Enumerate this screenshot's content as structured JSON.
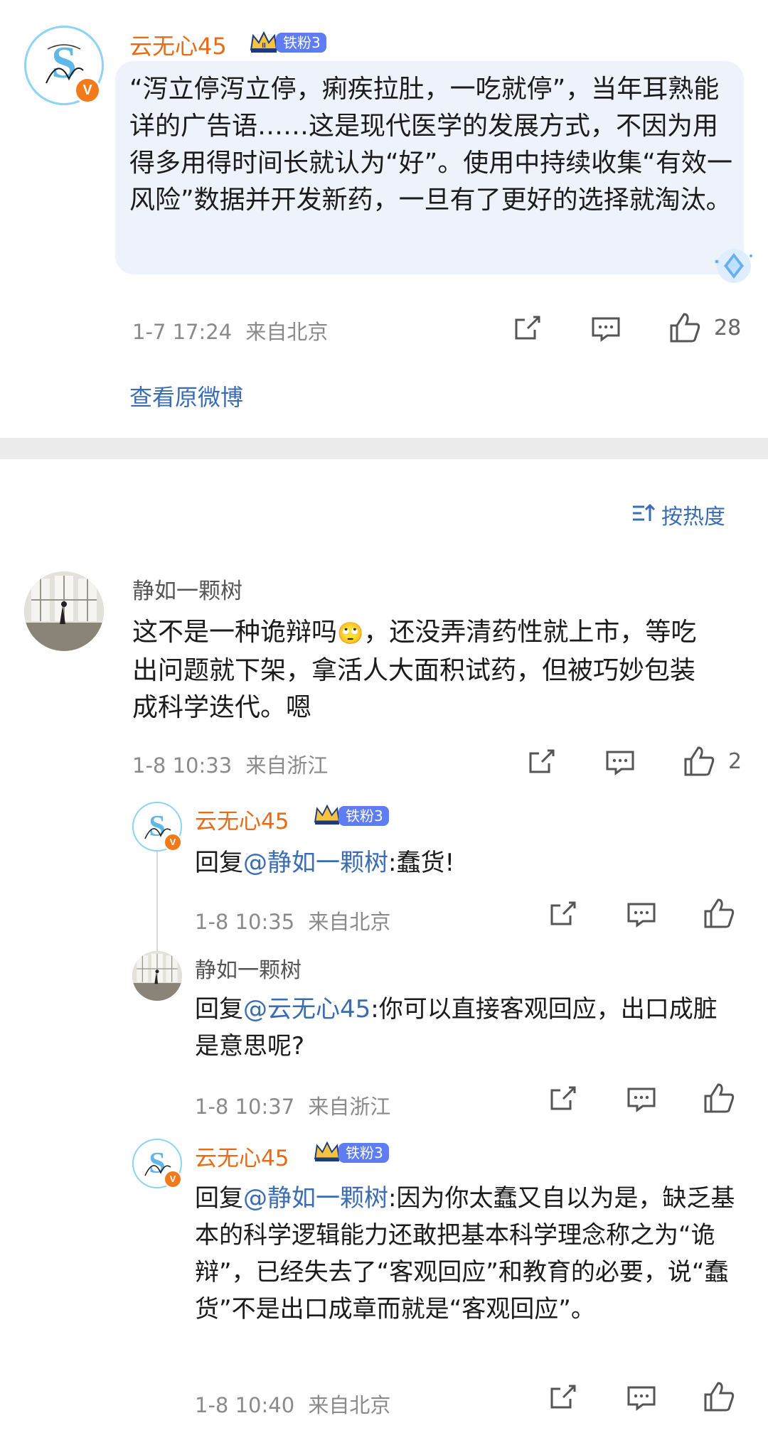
{
  "post": {
    "author": "云无心45",
    "fan_badge": "铁粉3",
    "text": "“泻立停泻立停，痢疾拉肚，一吃就停”，当年耳熟能详的广告语……这是现代医学的发展方式，不因为用得多用得时间长就认为“好”。使用中持续收集“有效一风险”数据并开发新药，一旦有了更好的选择就淘汰。",
    "time": "1-7 17:24",
    "location": "来自北京",
    "like_count": "28",
    "view_original": "查看原微博"
  },
  "sort_label": "按热度",
  "comments": [
    {
      "author": "静如一颗树",
      "text_before": "这不是一种诡辩吗",
      "emoji": "🙄",
      "text_after": "，还没弄清药性就上市，等吃出问题就下架，拿活人大面积试药，但被巧妙包装成科学迭代。嗯",
      "time": "1-8 10:33",
      "location": "来自浙江",
      "like_count": "2"
    }
  ],
  "replies": [
    {
      "author": "云无心45",
      "fan_badge": "铁粉3",
      "prefix": "回复",
      "mention": "@静如一颗树",
      "text": ":蠢货!",
      "time": "1-8 10:35",
      "location": "来自北京"
    },
    {
      "author": "静如一颗树",
      "prefix": "回复",
      "mention": "@云无心45",
      "text": ":你可以直接客观回应，出口成脏是意思呢?",
      "time": "1-8 10:37",
      "location": "来自浙江"
    },
    {
      "author": "云无心45",
      "fan_badge": "铁粉3",
      "prefix": "回复",
      "mention": "@静如一颗树",
      "text": ":因为你太蠢又自以为是，缺乏基本的科学逻辑能力还敢把基本科学理念称之为“诡辩”，已经失去了“客观回应”和教育的必要，说“蠢货”不是出口成章而就是“客观回应”。",
      "time": "1-8 10:40",
      "location": "来自北京"
    }
  ],
  "avatar_text": "S",
  "verified_mark": "V",
  "colors": {
    "username_orange": "#e86b16",
    "link_blue": "#3a6cb3",
    "badge_blue": "#5e7df3",
    "bubble_bg": "#eef2fb"
  },
  "icons": [
    "share-icon",
    "comment-icon",
    "like-icon",
    "sort-icon",
    "crown-icon",
    "diamond-icon"
  ]
}
